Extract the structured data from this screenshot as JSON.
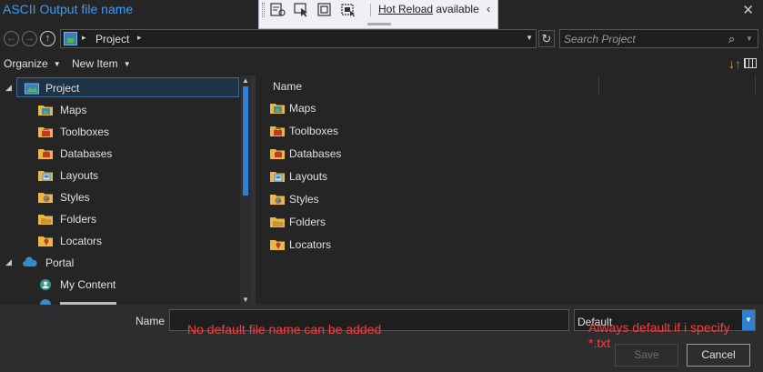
{
  "window": {
    "title": "ASCII Output file name",
    "close_glyph": "✕"
  },
  "hot_reload": {
    "link_text": "Hot Reload",
    "suffix_text": " available",
    "collapse_glyph": "‹"
  },
  "nav": {
    "back_glyph": "←",
    "forward_glyph": "→",
    "up_glyph": "↑",
    "address_crumb": "Project",
    "breadcrumb_separator": "▸",
    "address_drop_glyph": "▼",
    "refresh_glyph": "↻",
    "search_placeholder": "Search Project",
    "search_icon_glyph": "⌕",
    "search_drop_glyph": "▼"
  },
  "toolbar": {
    "organize_label": "Organize",
    "new_item_label": "New Item",
    "caret_glyph": "▼"
  },
  "tree": {
    "expand_glyph": "◢",
    "items": [
      {
        "label": "Project",
        "icon": "project-icon"
      },
      {
        "label": "Maps",
        "icon": "maps-folder-icon"
      },
      {
        "label": "Toolboxes",
        "icon": "toolboxes-folder-icon"
      },
      {
        "label": "Databases",
        "icon": "databases-folder-icon"
      },
      {
        "label": "Layouts",
        "icon": "layouts-folder-icon"
      },
      {
        "label": "Styles",
        "icon": "styles-folder-icon"
      },
      {
        "label": "Folders",
        "icon": "folders-folder-icon"
      },
      {
        "label": "Locators",
        "icon": "locators-folder-icon"
      },
      {
        "label": "Portal",
        "icon": "portal-cloud-icon"
      },
      {
        "label": "My Content",
        "icon": "my-content-icon"
      }
    ]
  },
  "list": {
    "column_name": "Name",
    "items": [
      {
        "label": "Maps",
        "icon": "maps-folder-icon"
      },
      {
        "label": "Toolboxes",
        "icon": "toolboxes-folder-icon"
      },
      {
        "label": "Databases",
        "icon": "databases-folder-icon"
      },
      {
        "label": "Layouts",
        "icon": "layouts-folder-icon"
      },
      {
        "label": "Styles",
        "icon": "styles-folder-icon"
      },
      {
        "label": "Folders",
        "icon": "folders-folder-icon"
      },
      {
        "label": "Locators",
        "icon": "locators-folder-icon"
      }
    ]
  },
  "footer": {
    "name_label": "Name",
    "name_value": "",
    "type_value": "Default",
    "type_drop_glyph": "▼",
    "save_label": "Save",
    "cancel_label": "Cancel"
  },
  "annotations": {
    "name_note": "No default file name can be added",
    "type_note_line1": "Always default if i specify",
    "type_note_line2": "*.txt"
  },
  "colors": {
    "accent_blue": "#2f7fd4",
    "title_blue": "#3c9df0",
    "annotation_red": "#ff3b3b",
    "folder_yellow": "#e8b84a"
  }
}
